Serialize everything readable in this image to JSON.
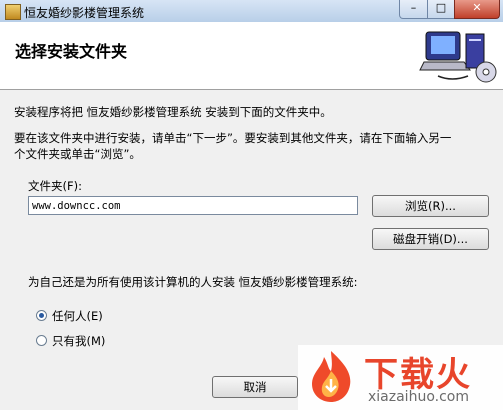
{
  "window": {
    "title": "恒友婚纱影楼管理系统",
    "close_glyph": "✕",
    "min_glyph": "–",
    "max_glyph": "□"
  },
  "header": {
    "title": "选择安装文件夹",
    "icon": "computer-install-icon"
  },
  "body": {
    "intro": "安装程序将把 恒友婚纱影楼管理系统 安装到下面的文件夹中。",
    "instruct_line1": "要在该文件夹中进行安装，请单击“下一步”。要安装到其他文件夹，请在下面输入另一",
    "instruct_line2": "个文件夹或单击“浏览”。",
    "folder_label": "文件夹(F):",
    "folder_value": "www.downcc.com",
    "browse_label": "浏览(R)...",
    "disk_cost_label": "磁盘开销(D)...",
    "scope_question": "为自己还是为所有使用该计算机的人安装 恒友婚纱影楼管理系统:",
    "radio_everyone": "任何人(E)",
    "radio_just_me": "只有我(M)",
    "selected": "everyone"
  },
  "footer": {
    "cancel_label": "取消"
  },
  "watermark": {
    "cn": "下载火",
    "en": "xiazaihuo.com"
  }
}
